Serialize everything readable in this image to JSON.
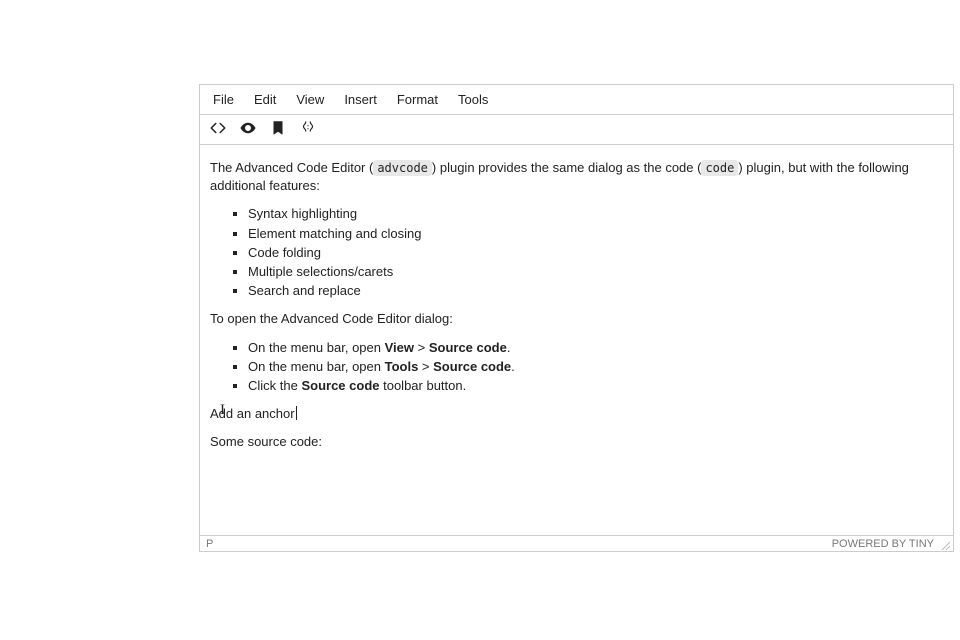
{
  "menubar": {
    "file": "File",
    "edit": "Edit",
    "view": "View",
    "insert": "Insert",
    "format": "Format",
    "tools": "Tools"
  },
  "toolbar": {
    "code": "Source code",
    "preview": "Preview",
    "anchor": "Anchor",
    "codesample": "Code sample"
  },
  "body": {
    "intro_prefix": "The Advanced Code Editor (",
    "intro_code1": "advcode",
    "intro_mid": ") plugin provides the same dialog as the code (",
    "intro_code2": "code",
    "intro_suffix": ") plugin, but with the following additional features:",
    "features": [
      "Syntax highlighting",
      "Element matching and closing",
      "Code folding",
      "Multiple selections/carets",
      "Search and replace"
    ],
    "open_dialog": "To open the Advanced Code Editor dialog:",
    "steps": {
      "s1_pre": "On the menu bar, open ",
      "s1_b1": "View",
      "s1_mid": " > ",
      "s1_b2": "Source code",
      "s1_post": ".",
      "s2_pre": "On the menu bar, open ",
      "s2_b1": "Tools",
      "s2_mid": " > ",
      "s2_b2": "Source code",
      "s2_post": ".",
      "s3_pre": "Click the ",
      "s3_b1": "Source code",
      "s3_post": " toolbar button."
    },
    "anchor_line": "Add an anchor",
    "source_line": "Some source code:"
  },
  "statusbar": {
    "path": "P",
    "branding": "POWERED BY TINY"
  }
}
